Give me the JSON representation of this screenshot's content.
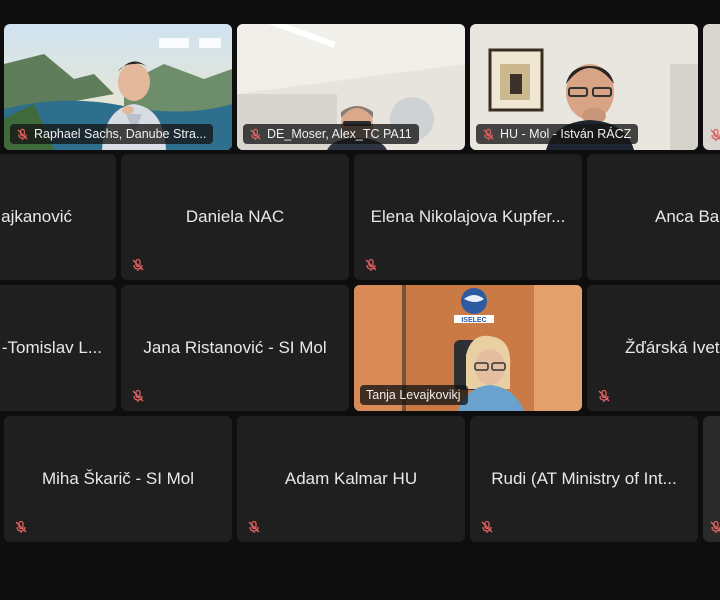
{
  "accent_muted_color": "#d9534f",
  "video_tiles": [
    {
      "name": "Raphael Sachs, Danube Stra...",
      "muted": true
    },
    {
      "name": "DE_Moser, Alex_TC PA11",
      "muted": true
    },
    {
      "name": "HU - Mol - István RÁCZ",
      "muted": true
    },
    {
      "name": "Tanja Levajkovikj",
      "muted": false
    }
  ],
  "tiles": [
    {
      "name": "ajkanović"
    },
    {
      "name": "Daniela NAC"
    },
    {
      "name": "Elena Nikolajova Kupfer..."
    },
    {
      "name": "Anca Ba"
    },
    {
      "name": "-Tomislav L..."
    },
    {
      "name": "Jana Ristanović - SI Mol"
    },
    {
      "name": "Žďárská Ivet"
    },
    {
      "name": "Miha Škarič - SI Mol"
    },
    {
      "name": "Adam Kalmar HU"
    },
    {
      "name": "Rudi (AT Ministry of Int..."
    }
  ],
  "logo_text": "ISELEC"
}
